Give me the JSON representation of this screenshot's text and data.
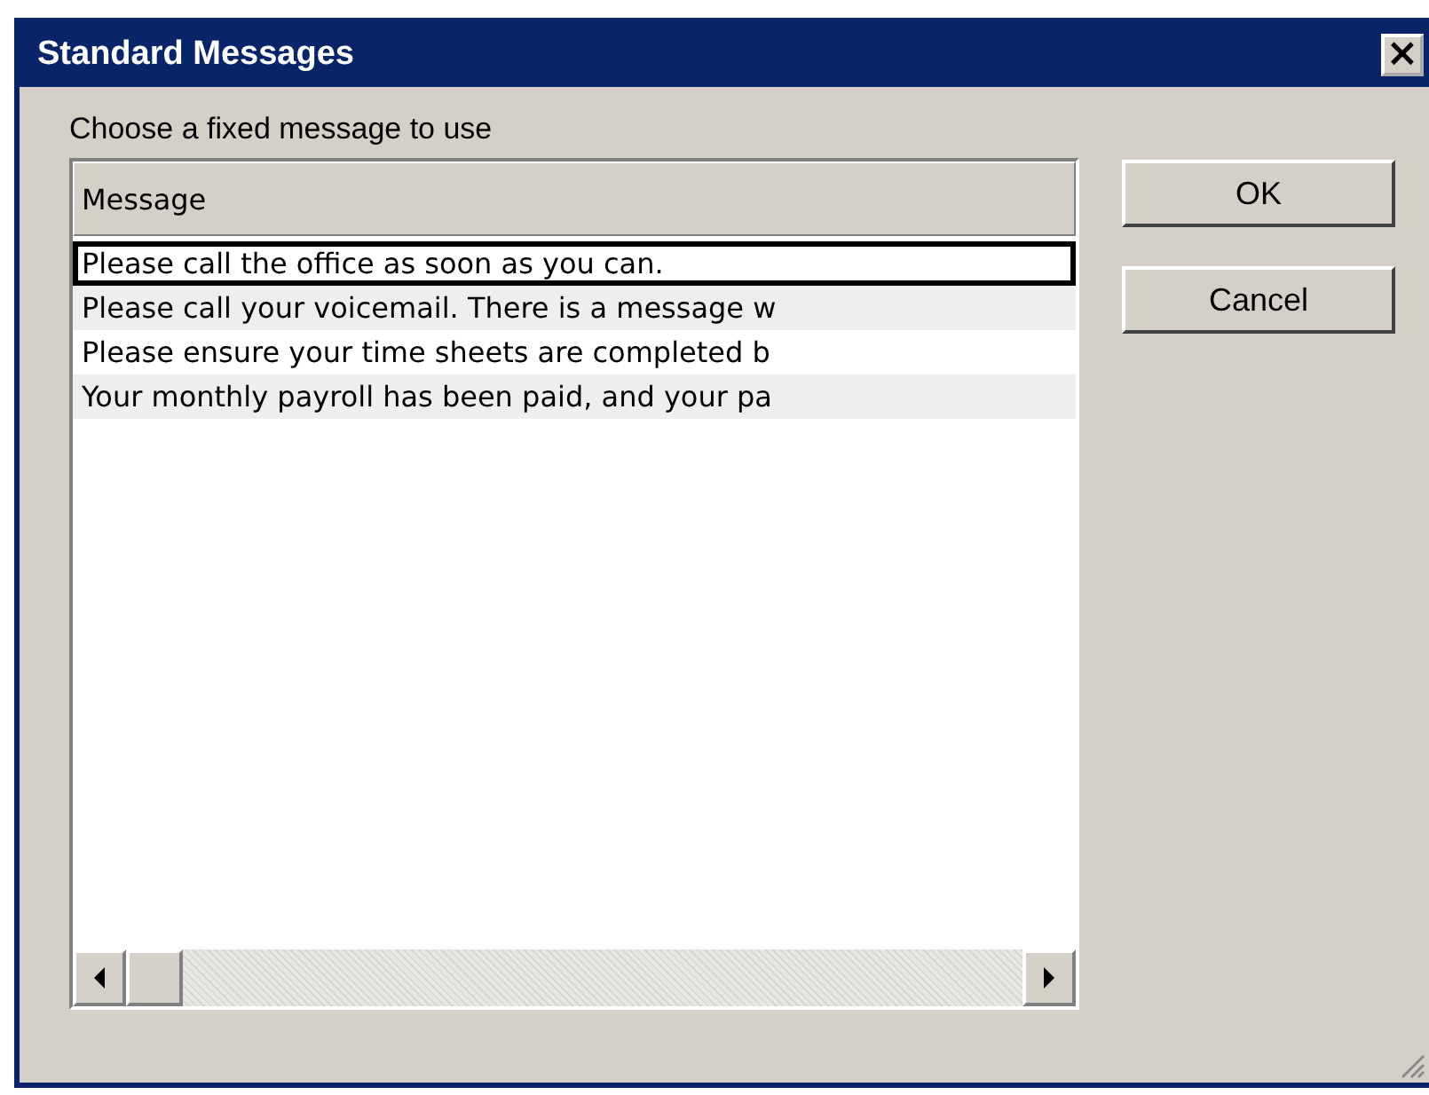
{
  "window": {
    "title": "Standard Messages",
    "close_glyph": "×"
  },
  "prompt": "Choose a fixed message to use",
  "list": {
    "columns": [
      "Message"
    ],
    "rows": [
      {
        "text": "Please call the office as soon as you can.",
        "selected": true
      },
      {
        "text": "Please call your voicemail. There is a message w",
        "selected": false
      },
      {
        "text": "Please ensure your time sheets are completed b",
        "selected": false
      },
      {
        "text": "Your monthly payroll has been paid, and your pa",
        "selected": false
      }
    ]
  },
  "buttons": [
    "OK",
    "Cancel"
  ]
}
